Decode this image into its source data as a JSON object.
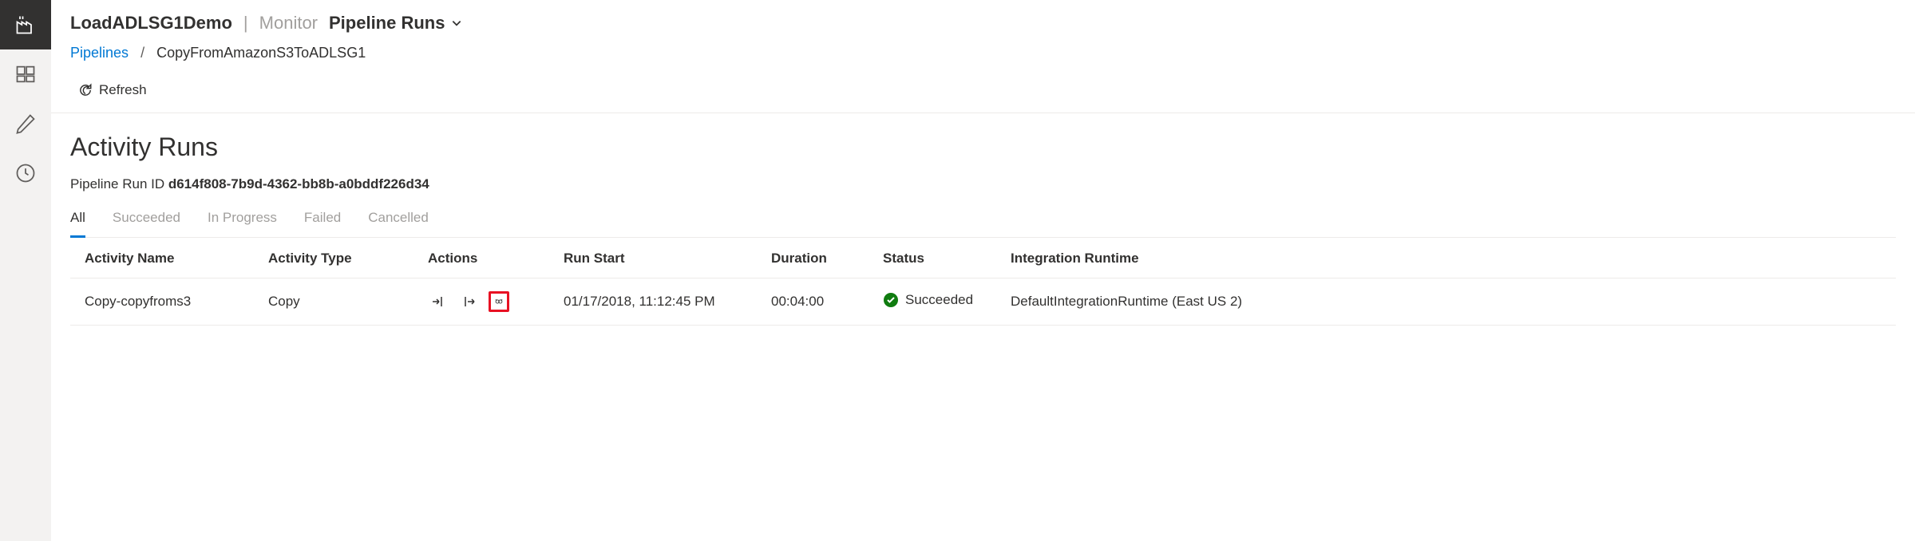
{
  "header": {
    "title": "LoadADLSG1Demo",
    "section": "Monitor",
    "dropdown": "Pipeline Runs"
  },
  "breadcrumb": {
    "link": "Pipelines",
    "current": "CopyFromAmazonS3ToADLSG1"
  },
  "toolbar": {
    "refresh_label": "Refresh"
  },
  "page": {
    "heading": "Activity Runs",
    "run_id_label": "Pipeline Run ID ",
    "run_id_value": "d614f808-7b9d-4362-bb8b-a0bddf226d34"
  },
  "filter_tabs": [
    "All",
    "Succeeded",
    "In Progress",
    "Failed",
    "Cancelled"
  ],
  "columns": {
    "activity_name": "Activity Name",
    "activity_type": "Activity Type",
    "actions": "Actions",
    "run_start": "Run Start",
    "duration": "Duration",
    "status": "Status",
    "integration_runtime": "Integration Runtime"
  },
  "rows": [
    {
      "activity_name": "Copy-copyfroms3",
      "activity_type": "Copy",
      "run_start": "01/17/2018, 11:12:45 PM",
      "duration": "00:04:00",
      "status": "Succeeded",
      "integration_runtime": "DefaultIntegrationRuntime (East US 2)"
    }
  ]
}
